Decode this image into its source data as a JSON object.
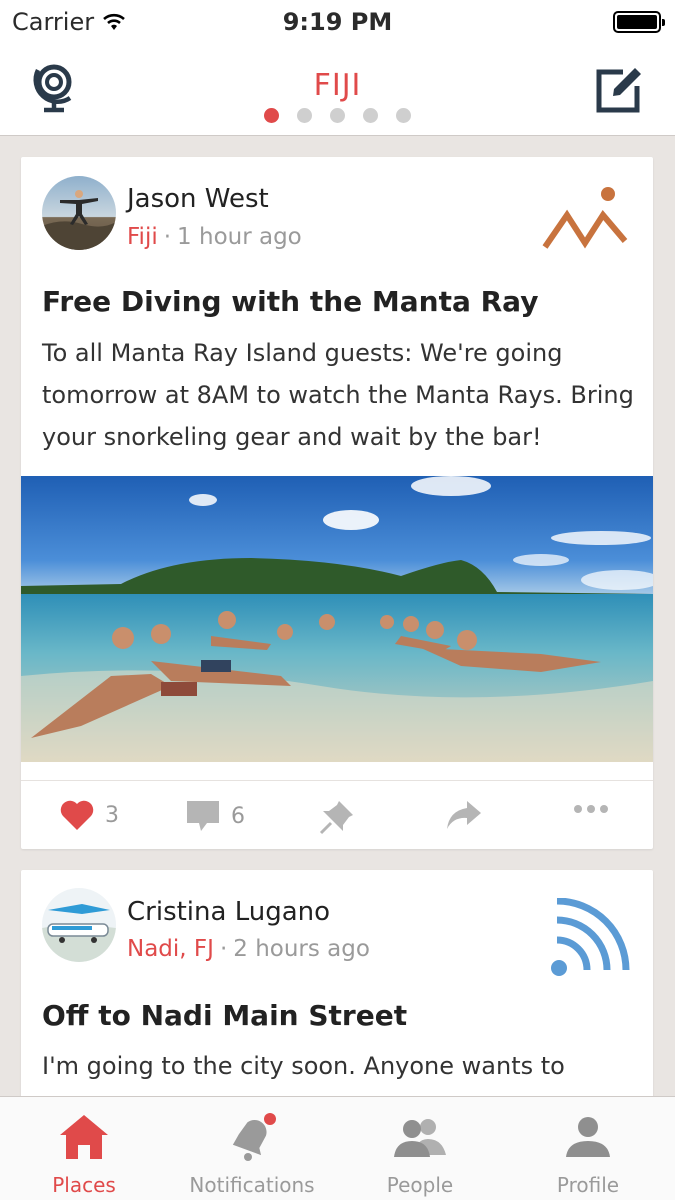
{
  "status_bar": {
    "carrier": "Carrier",
    "time": "9:19 PM"
  },
  "nav": {
    "title": "FIJI",
    "page_dots": 5,
    "active_dot": 0,
    "left_icon": "globe-icon",
    "right_icon": "compose-icon"
  },
  "posts": [
    {
      "author": "Jason West",
      "location": "Fiji",
      "separator": "·",
      "time": "1 hour ago",
      "title": "Free Diving with the Manta Ray",
      "body": "To all Manta Ray Island guests: We're going tomorrow at 8AM to watch the Manta Rays. Bring your snorkeling gear and wait by the bar!",
      "type_icon": "mountains-icon",
      "actions": {
        "likes": "3",
        "comments": "6"
      }
    },
    {
      "author": "Cristina Lugano",
      "location": "Nadi, FJ",
      "separator": "·",
      "time": "2 hours ago",
      "title": "Off to Nadi Main Street",
      "body": "I'm going to  the city soon. Anyone wants to",
      "type_icon": "broadcast-icon"
    }
  ],
  "tabs": [
    {
      "label": "Places",
      "icon": "house-icon",
      "active": true
    },
    {
      "label": "Notifications",
      "icon": "bell-icon",
      "badge": true
    },
    {
      "label": "People",
      "icon": "people-icon"
    },
    {
      "label": "Profile",
      "icon": "person-icon"
    }
  ],
  "colors": {
    "accent": "#e04a4a",
    "mountain": "#c8733e",
    "broadcast": "#5b9bd5",
    "icon_gray": "#9a9a9a",
    "nav_icon": "#2a3a4a"
  }
}
